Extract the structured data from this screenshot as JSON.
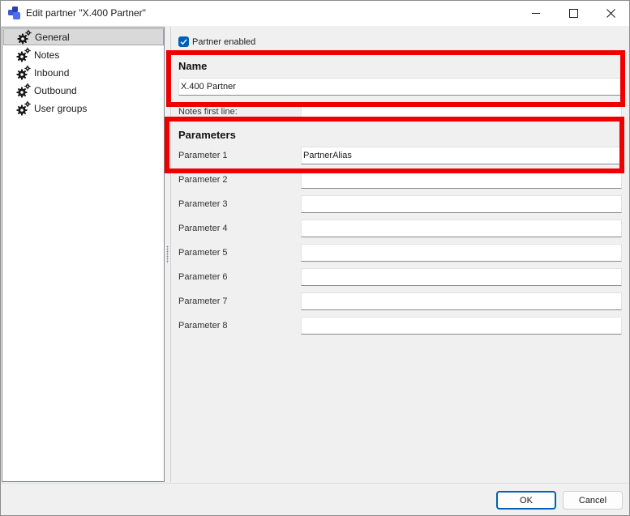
{
  "window": {
    "title": "Edit partner \"X.400 Partner\"",
    "icons": {
      "app": "app-logo-icon",
      "minimize": "minimize-icon",
      "maximize": "maximize-icon",
      "close": "close-icon"
    }
  },
  "tree": {
    "items": [
      {
        "label": "General",
        "icon": "gear-icon",
        "selected": true
      },
      {
        "label": "Notes",
        "icon": "gear-icon",
        "selected": false
      },
      {
        "label": "Inbound",
        "icon": "gear-icon",
        "selected": false
      },
      {
        "label": "Outbound",
        "icon": "gear-icon",
        "selected": false
      },
      {
        "label": "User groups",
        "icon": "gear-icon",
        "selected": false
      }
    ]
  },
  "general": {
    "partner_enabled": {
      "label": "Partner enabled",
      "checked": true
    },
    "name": {
      "header": "Name",
      "value": "X.400 Partner"
    },
    "notes_first_line": {
      "label": "Notes first line:",
      "value": ""
    },
    "parameters": {
      "header": "Parameters",
      "items": [
        {
          "label": "Parameter 1",
          "value": "PartnerAlias"
        },
        {
          "label": "Parameter 2",
          "value": ""
        },
        {
          "label": "Parameter 3",
          "value": ""
        },
        {
          "label": "Parameter 4",
          "value": ""
        },
        {
          "label": "Parameter 5",
          "value": ""
        },
        {
          "label": "Parameter 6",
          "value": ""
        },
        {
          "label": "Parameter 7",
          "value": ""
        },
        {
          "label": "Parameter 8",
          "value": ""
        }
      ]
    }
  },
  "footer": {
    "ok_label": "OK",
    "cancel_label": "Cancel"
  },
  "colors": {
    "highlight": "#ee0000",
    "accent": "#005fb8",
    "selection": "#d9d9d9"
  }
}
